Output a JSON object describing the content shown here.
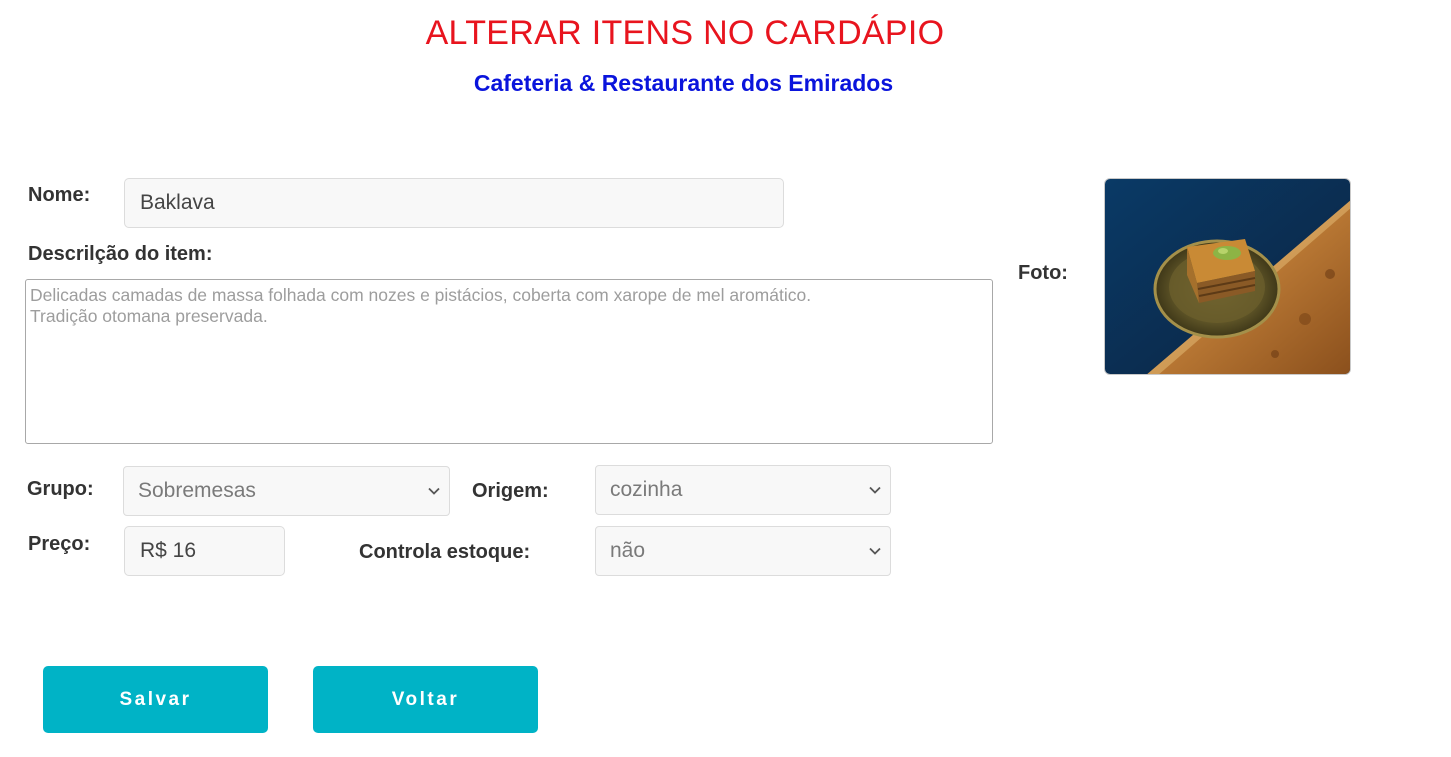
{
  "header": {
    "title": "ALTERAR ITENS NO CARDÁPIO",
    "subtitle": "Cafeteria & Restaurante dos Emirados"
  },
  "form": {
    "nome": {
      "label": "Nome:",
      "value": "Baklava"
    },
    "descricao": {
      "label": "Descrilção do item:",
      "value": "Delicadas camadas de massa folhada com nozes e pistácios, coberta com xarope de mel aromático.\nTradição otomana preservada."
    },
    "grupo": {
      "label": "Grupo:",
      "value": "Sobremesas"
    },
    "origem": {
      "label": "Origem:",
      "value": "cozinha"
    },
    "preco": {
      "label": "Preço:",
      "value": "R$ 16"
    },
    "controla_estoque": {
      "label": "Controla estoque:",
      "value": "não"
    },
    "foto": {
      "label": "Foto:"
    }
  },
  "buttons": {
    "save_label": "Salvar",
    "back_label": "Voltar"
  },
  "colors": {
    "title": "#e8141e",
    "subtitle": "#0a14dc",
    "button": "#00b3c6"
  },
  "icons": {
    "select_chevron": "chevron-down-icon"
  }
}
